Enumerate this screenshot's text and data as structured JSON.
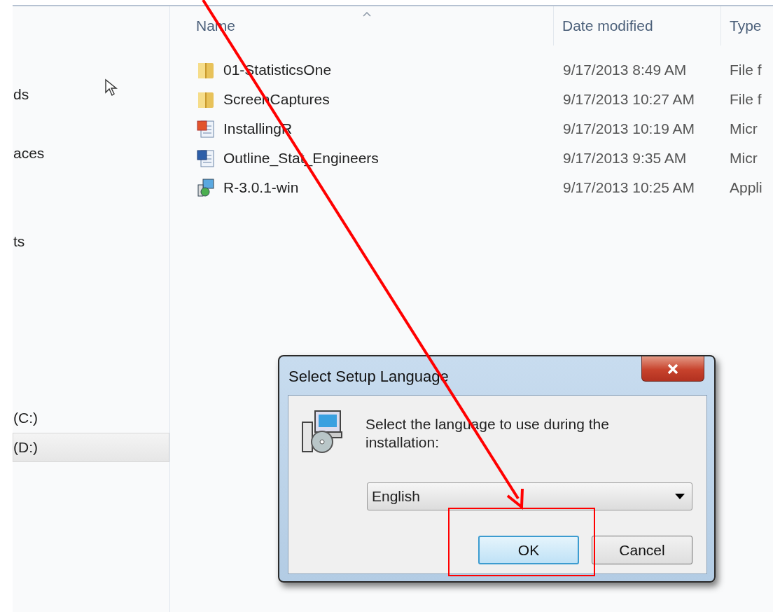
{
  "sidebar": {
    "items": [
      {
        "label": "ds",
        "selected": false
      },
      {
        "label": "aces",
        "selected": false
      },
      {
        "label": "ts",
        "selected": false
      },
      {
        "label": "(C:)",
        "selected": false
      },
      {
        "label": "(D:)",
        "selected": true
      }
    ]
  },
  "file_list": {
    "columns": [
      "Name",
      "Date modified",
      "Type"
    ],
    "rows": [
      {
        "kind": "folder",
        "name": "01-StatisticsOne",
        "date": "9/17/2013 8:49 AM",
        "type": "File f"
      },
      {
        "kind": "folder",
        "name": "ScreenCaptures",
        "date": "9/17/2013 10:27 AM",
        "type": "File f"
      },
      {
        "kind": "presentation",
        "name": "InstallingR",
        "date": "9/17/2013 10:19 AM",
        "type": "Micr"
      },
      {
        "kind": "document",
        "name": "Outline_Stat_Engineers",
        "date": "9/17/2013 9:35 AM",
        "type": "Micr"
      },
      {
        "kind": "installer",
        "name": "R-3.0.1-win",
        "date": "9/17/2013 10:25 AM",
        "type": "Appli"
      }
    ]
  },
  "dialog": {
    "title": "Select Setup Language",
    "message": "Select the language to use during the installation:",
    "language": "English",
    "buttons": [
      {
        "label": "OK",
        "default": true
      },
      {
        "label": "Cancel",
        "default": false
      }
    ]
  }
}
